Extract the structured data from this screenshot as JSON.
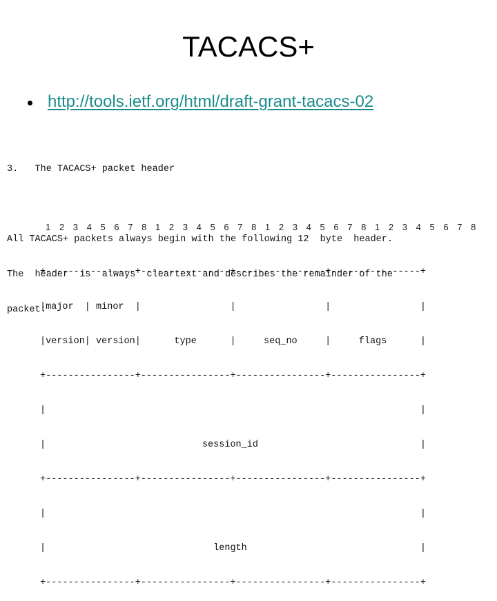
{
  "slide": {
    "title": "TACACS+",
    "bullets": [
      {
        "text": "http://tools.ietf.org/html/draft-grant-tacacs-02",
        "is_link": true
      }
    ],
    "link_color": "#1c8c8c"
  },
  "rfc_excerpt": {
    "lines": [
      "3.   The TACACS+ packet header",
      "",
      "All TACACS+ packets always begin with the following 12  byte  header.",
      "The  header  is  always  cleartext and describes the remainder of the",
      "packet:"
    ]
  },
  "packet_diagram": {
    "bit_labels": [
      [
        "1",
        "2",
        "3",
        "4",
        "5",
        "6",
        "7",
        "8"
      ],
      [
        "1",
        "2",
        "3",
        "4",
        "5",
        "6",
        "7",
        "8"
      ],
      [
        "1",
        "2",
        "3",
        "4",
        "5",
        "6",
        "7",
        "8"
      ],
      [
        "1",
        "2",
        "3",
        "4",
        "5",
        "6",
        "7",
        "8"
      ]
    ],
    "lines": [
      "+----------------+----------------+----------------+----------------+",
      "|major  | minor  |                |                |                |",
      "|version| version|      type      |     seq_no     |     flags      |",
      "+----------------+----------------+----------------+----------------+",
      "|                                                                   |",
      "|                            session_id                             |",
      "+----------------+----------------+----------------+----------------+",
      "|                                                                   |",
      "|                              length                               |",
      "+----------------+----------------+----------------+----------------+"
    ],
    "fields": [
      "major version",
      "minor version",
      "type",
      "seq_no",
      "flags",
      "session_id",
      "length"
    ]
  }
}
